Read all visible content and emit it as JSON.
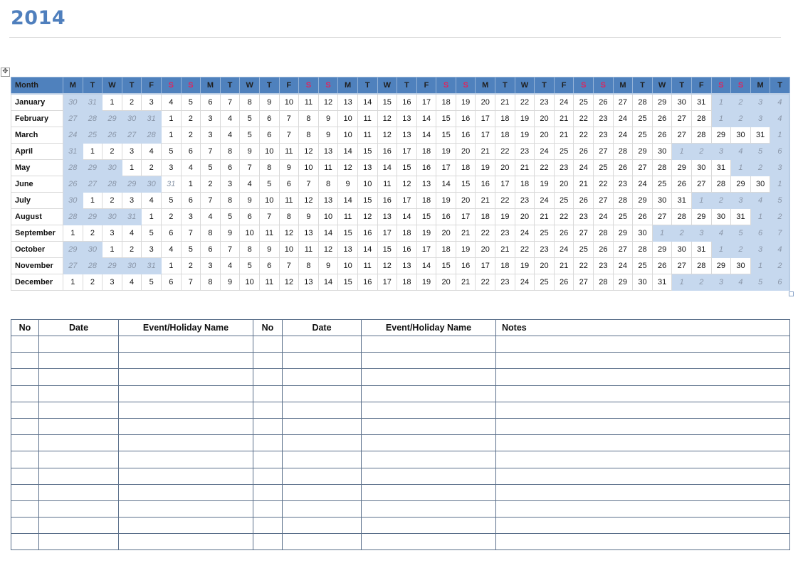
{
  "document": {
    "title": "2014"
  },
  "calendar": {
    "month_header": "Month",
    "day_headers": [
      "M",
      "T",
      "W",
      "T",
      "F",
      "S",
      "S",
      "M",
      "T",
      "W",
      "T",
      "F",
      "S",
      "S",
      "M",
      "T",
      "W",
      "T",
      "F",
      "S",
      "S",
      "M",
      "T",
      "W",
      "T",
      "F",
      "S",
      "S",
      "M",
      "T",
      "W",
      "T",
      "F",
      "S",
      "S",
      "M",
      "T"
    ],
    "weekend_color": "#e0245e",
    "header_color": "#4f81bd",
    "shade_color": "#c6d8ee",
    "months": [
      {
        "name": "January",
        "offset": 2,
        "days": 31,
        "prev": [
          "30",
          "31"
        ]
      },
      {
        "name": "February",
        "offset": 5,
        "days": 28,
        "prev": [
          "27",
          "28",
          "29",
          "30",
          "31"
        ]
      },
      {
        "name": "March",
        "offset": 5,
        "days": 31,
        "prev": [
          "24",
          "25",
          "26",
          "27",
          "28"
        ]
      },
      {
        "name": "April",
        "offset": 1,
        "days": 30,
        "prev": [
          "31"
        ]
      },
      {
        "name": "May",
        "offset": 3,
        "days": 31,
        "prev": [
          "28",
          "29",
          "30"
        ]
      },
      {
        "name": "June",
        "offset": 6,
        "days": 30,
        "prev": [
          "26",
          "27",
          "28",
          "29",
          "30",
          "31"
        ],
        "unshaded_prev": [
          5
        ]
      },
      {
        "name": "July",
        "offset": 1,
        "days": 31,
        "prev": [
          "30"
        ]
      },
      {
        "name": "August",
        "offset": 4,
        "days": 31,
        "prev": [
          "28",
          "29",
          "30",
          "31"
        ]
      },
      {
        "name": "September",
        "offset": 0,
        "days": 30,
        "prev": []
      },
      {
        "name": "October",
        "offset": 2,
        "days": 31,
        "prev": [
          "29",
          "30"
        ]
      },
      {
        "name": "November",
        "offset": 5,
        "days": 30,
        "prev": [
          "27",
          "28",
          "29",
          "30",
          "31"
        ]
      },
      {
        "name": "December",
        "offset": 0,
        "days": 31,
        "prev": []
      }
    ]
  },
  "events_table": {
    "headers": [
      "No",
      "Date",
      "Event/Holiday Name",
      "No",
      "Date",
      "Event/Holiday Name",
      "Notes"
    ],
    "row_count": 13
  }
}
